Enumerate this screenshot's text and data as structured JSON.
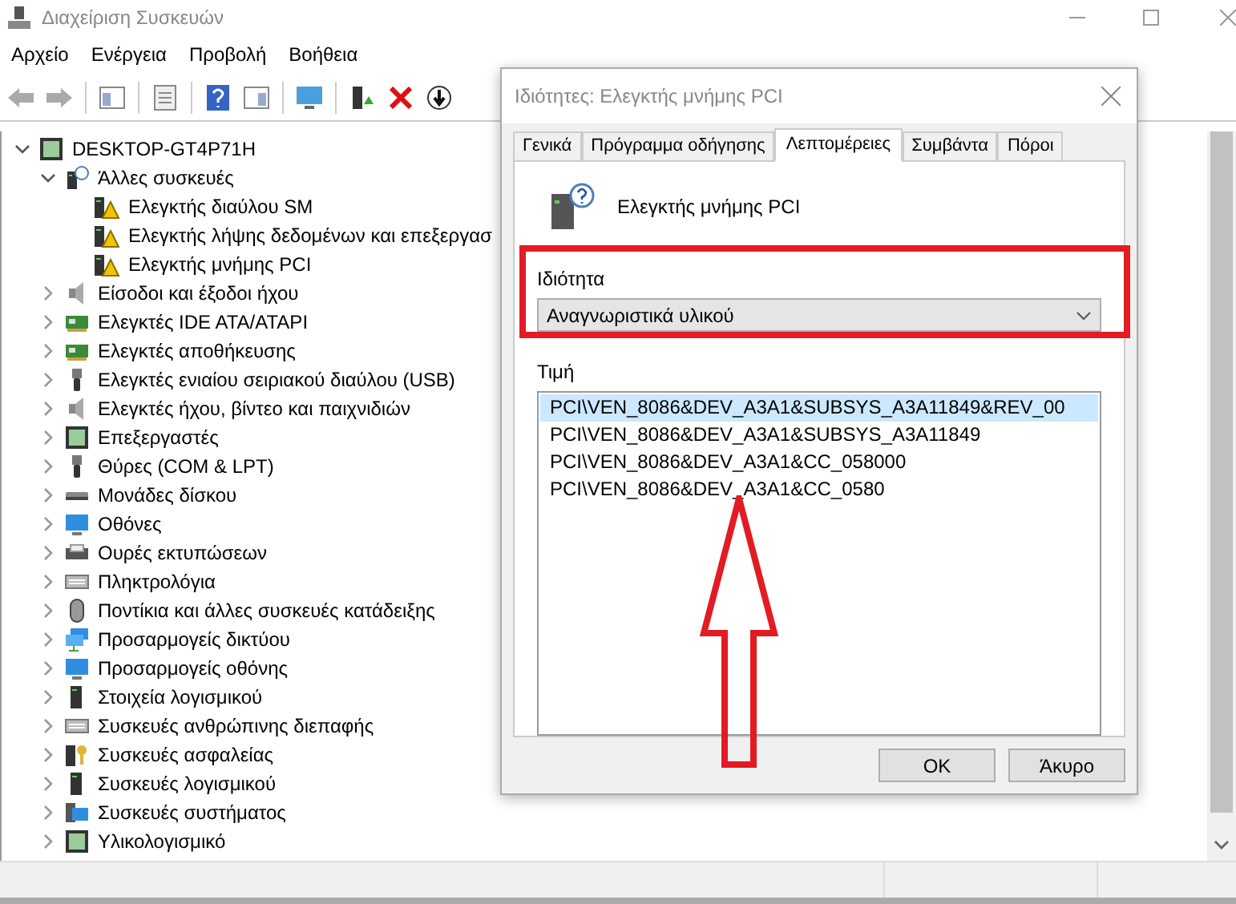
{
  "main_window": {
    "title": "Διαχείριση Συσκευών",
    "menu": [
      "Αρχείο",
      "Ενέργεια",
      "Προβολή",
      "Βοήθεια"
    ],
    "tree": {
      "label": "DESKTOP-GT4P71H",
      "expanded": true,
      "children": [
        {
          "label": "Άλλες συσκευές",
          "expanded": true,
          "children": [
            {
              "label": "Ελεγκτής διαύλου SM",
              "warning": true
            },
            {
              "label": "Ελεγκτής λήψης δεδομένων και επεξεργασ",
              "warning": true
            },
            {
              "label": "Ελεγκτής μνήμης PCI",
              "warning": true
            }
          ]
        },
        {
          "label": "Είσοδοι και έξοδοι ήχου",
          "expanded": false
        },
        {
          "label": "Ελεγκτές IDE ATA/ATAPI",
          "expanded": false
        },
        {
          "label": "Ελεγκτές αποθήκευσης",
          "expanded": false
        },
        {
          "label": "Ελεγκτές ενιαίου σειριακού διαύλου (USB)",
          "expanded": false
        },
        {
          "label": "Ελεγκτές ήχου, βίντεο και παιχνιδιών",
          "expanded": false
        },
        {
          "label": "Επεξεργαστές",
          "expanded": false
        },
        {
          "label": "Θύρες (COM & LPT)",
          "expanded": false
        },
        {
          "label": "Μονάδες δίσκου",
          "expanded": false
        },
        {
          "label": "Οθόνες",
          "expanded": false
        },
        {
          "label": "Ουρές εκτυπώσεων",
          "expanded": false
        },
        {
          "label": "Πληκτρολόγια",
          "expanded": false
        },
        {
          "label": "Ποντίκια και άλλες συσκευές κατάδειξης",
          "expanded": false
        },
        {
          "label": "Προσαρμογείς δικτύου",
          "expanded": false
        },
        {
          "label": "Προσαρμογείς οθόνης",
          "expanded": false
        },
        {
          "label": "Στοιχεία λογισμικού",
          "expanded": false
        },
        {
          "label": "Συσκευές ανθρώπινης διεπαφής",
          "expanded": false
        },
        {
          "label": "Συσκευές ασφαλείας",
          "expanded": false
        },
        {
          "label": "Συσκευές λογισμικού",
          "expanded": false
        },
        {
          "label": "Συσκευές συστήματος",
          "expanded": false
        },
        {
          "label": "Υλικολογισμικό",
          "expanded": false
        }
      ]
    }
  },
  "dialog": {
    "title": "Ιδιότητες: Ελεγκτής μνήμης PCI",
    "tabs": [
      {
        "label": "Γενικά",
        "selected": false
      },
      {
        "label": "Πρόγραμμα οδήγησης",
        "selected": false
      },
      {
        "label": "Λεπτομέρειες",
        "selected": true
      },
      {
        "label": "Συμβάντα",
        "selected": false
      },
      {
        "label": "Πόροι",
        "selected": false
      }
    ],
    "device_name": "Ελεγκτής μνήμης PCI",
    "property_label": "Ιδιότητα",
    "property_value": "Αναγνωριστικά υλικού",
    "value_label": "Τιμή",
    "values": [
      {
        "text": "PCI\\VEN_8086&DEV_A3A1&SUBSYS_A3A11849&REV_00",
        "selected": true
      },
      {
        "text": "PCI\\VEN_8086&DEV_A3A1&SUBSYS_A3A11849",
        "selected": false
      },
      {
        "text": "PCI\\VEN_8086&DEV_A3A1&CC_058000",
        "selected": false
      },
      {
        "text": "PCI\\VEN_8086&DEV_A3A1&CC_0580",
        "selected": false
      }
    ],
    "buttons": [
      "OK",
      "Άκυρο"
    ]
  }
}
